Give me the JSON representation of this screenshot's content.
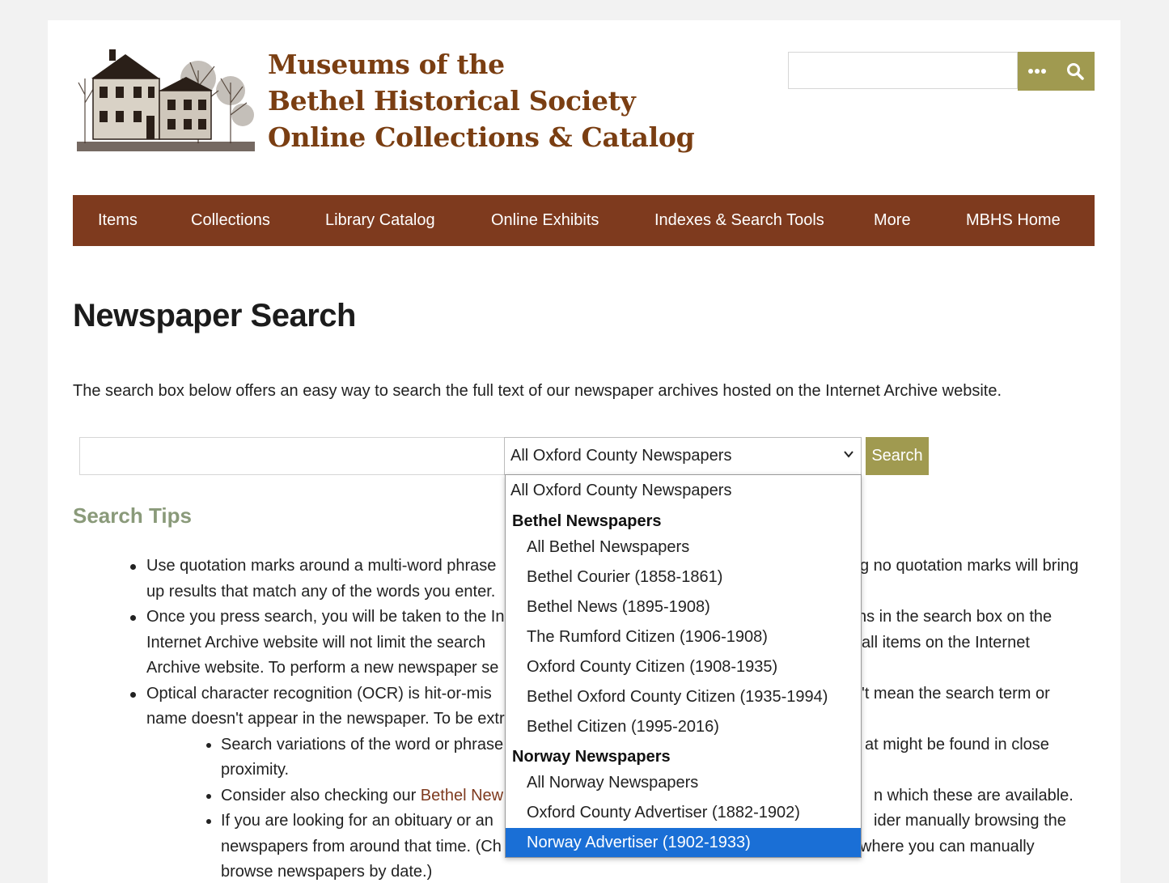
{
  "header": {
    "logo_lines": [
      "Museums of the",
      "Bethel Historical Society",
      "Online Collections & Catalog"
    ],
    "search_placeholder": "",
    "more_icon": "ellipsis-icon",
    "search_icon": "magnifier-icon",
    "colors": {
      "brand": "#7a3e12",
      "accent": "#a09a50",
      "nav": "#7e3a1e"
    }
  },
  "nav": {
    "items": [
      "Items",
      "Collections",
      "Library Catalog",
      "Online Exhibits",
      "Indexes & Search Tools",
      "More",
      "MBHS Home"
    ]
  },
  "main": {
    "title": "Newspaper Search",
    "intro": "The search box below offers an easy way to search the full text of our newspaper archives hosted on the Internet Archive website.",
    "search": {
      "input_value": "",
      "selected": "All Oxford County Newspapers",
      "button": "Search"
    },
    "tips_heading": "Search Tips",
    "tips_lines": [
      "Use quotation marks around a multi-word phrase",
      "g no quotation marks will bring",
      "up results that match any of the words you enter.",
      "Once you press search, you will be taken to the In",
      "ns in the search box on the",
      "Internet Archive website will not limit the search",
      "all items on the Internet",
      "Archive website. To perform a new newspaper se",
      "Optical character recognition (OCR) is hit-or-mis",
      "'t mean the search term or",
      "name doesn't appear in the newspaper. To be extr",
      "Search variations of the word or phrase",
      "at might be found in close",
      "proximity.",
      "Consider also checking our ",
      "Bethel New",
      "n which these are available.",
      "If you are looking for an obituary or an",
      "ider manually browsing the",
      "newspapers from around that time. (Ch",
      "where you can manually",
      "browse newspapers by date.)"
    ]
  },
  "dropdown": {
    "options": [
      {
        "label": "All Oxford County Newspapers",
        "kind": "top"
      },
      {
        "label": "Bethel Newspapers",
        "kind": "group"
      },
      {
        "label": "All Bethel Newspapers",
        "kind": "sub"
      },
      {
        "label": "Bethel Courier (1858-1861)",
        "kind": "sub"
      },
      {
        "label": "Bethel News (1895-1908)",
        "kind": "sub"
      },
      {
        "label": "The Rumford Citizen (1906-1908)",
        "kind": "sub"
      },
      {
        "label": "Oxford County Citizen (1908-1935)",
        "kind": "sub"
      },
      {
        "label": "Bethel Oxford County Citizen (1935-1994)",
        "kind": "sub"
      },
      {
        "label": "Bethel Citizen (1995-2016)",
        "kind": "sub"
      },
      {
        "label": "Norway Newspapers",
        "kind": "group"
      },
      {
        "label": "All Norway Newspapers",
        "kind": "sub"
      },
      {
        "label": "Oxford County Advertiser (1882-1902)",
        "kind": "sub"
      },
      {
        "label": "Norway Advertiser (1902-1933)",
        "kind": "sub",
        "highlighted": true
      }
    ]
  }
}
